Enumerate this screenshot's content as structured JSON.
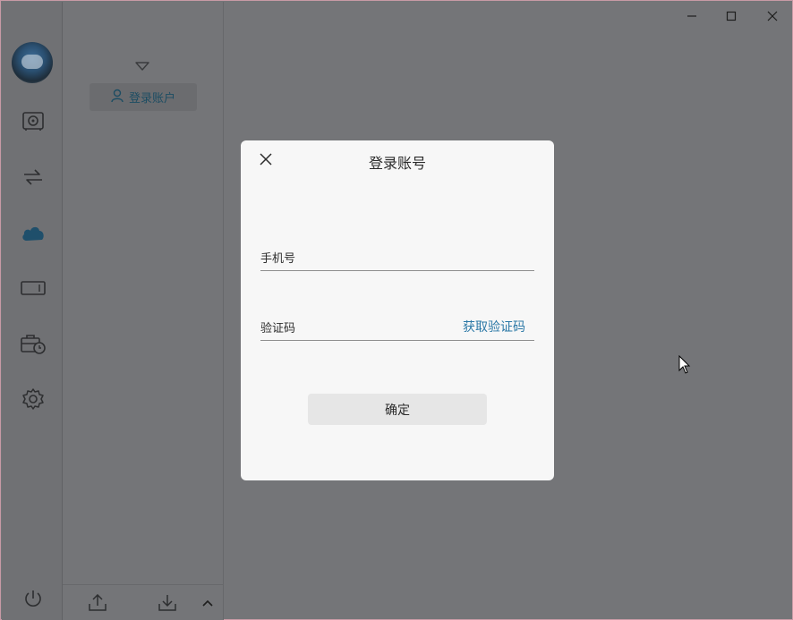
{
  "window": {
    "controls": [
      "minimize-icon",
      "maximize-icon",
      "close-icon"
    ]
  },
  "sidebar": {
    "items": [
      {
        "name": "storage",
        "icon": "safe-icon"
      },
      {
        "name": "transfer",
        "icon": "swap-arrows-icon"
      },
      {
        "name": "cloud",
        "icon": "cloud-icon",
        "active": true
      },
      {
        "name": "device",
        "icon": "drive-icon"
      },
      {
        "name": "toolbox",
        "icon": "briefcase-clock-icon"
      },
      {
        "name": "settings",
        "icon": "gear-icon"
      }
    ],
    "power_icon": "power-icon"
  },
  "panel": {
    "login_label": "登录账户",
    "footer_icons": [
      "upload-icon",
      "download-icon",
      "chevron-up-icon"
    ]
  },
  "dialog": {
    "title": "登录账号",
    "phone_label": "手机号",
    "code_label": "验证码",
    "get_code_label": "获取验证码",
    "confirm_label": "确定"
  },
  "colors": {
    "accent": "#2b78a6",
    "active_icon": "#1f4f6b",
    "dialog_bg": "#f7f7f7"
  }
}
